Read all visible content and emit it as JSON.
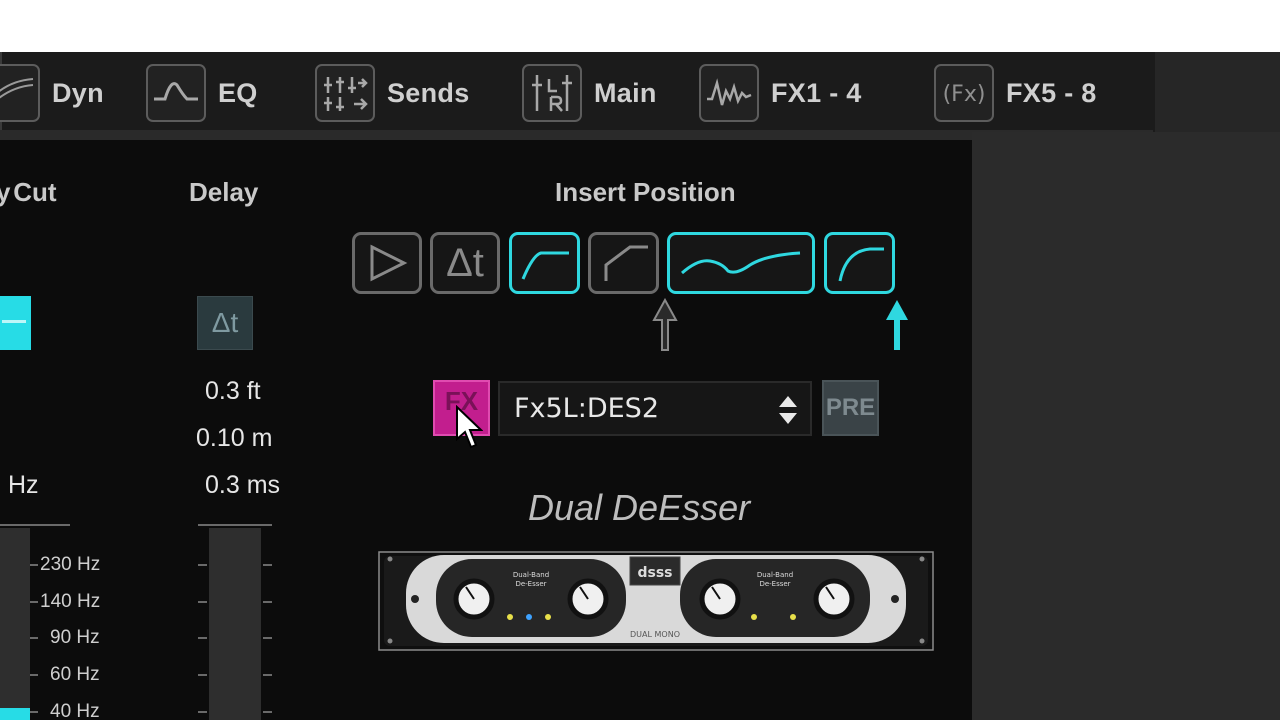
{
  "tabs": [
    {
      "label": "Dyn",
      "icon": "dynamics-icon"
    },
    {
      "label": "EQ",
      "icon": "eq-curve-icon"
    },
    {
      "label": "Sends",
      "icon": "sends-faders-icon"
    },
    {
      "label": "Main",
      "icon": "main-lr-icon"
    },
    {
      "label": "FX1 - 4",
      "icon": "fx-wave-icon"
    },
    {
      "label": "FX5 - 8",
      "icon": "fx-bracket-icon"
    }
  ],
  "section_headers": {
    "low_cut": "Cut",
    "delay": "Delay",
    "insert_position": "Insert Position"
  },
  "low_cut": {
    "value_unit": "Hz",
    "scale": [
      "230 Hz",
      "140 Hz",
      "90 Hz",
      "60 Hz",
      "40 Hz"
    ]
  },
  "delay": {
    "button_label": "Δt",
    "feet": "0.3 ft",
    "meters": "0.10 m",
    "ms": "0.3 ms"
  },
  "insert_positions": [
    {
      "name": "input",
      "icon": "play-triangle-icon",
      "active": false
    },
    {
      "name": "delay",
      "icon": "delta-t-icon",
      "label": "Δt",
      "active": false
    },
    {
      "name": "low-cut",
      "icon": "low-cut-curve-icon",
      "active": true
    },
    {
      "name": "gate",
      "icon": "gate-curve-icon",
      "active": false
    },
    {
      "name": "eq",
      "icon": "eq-wave-icon",
      "active": true
    },
    {
      "name": "dynamics",
      "icon": "compressor-curve-icon",
      "active": true
    }
  ],
  "fx_insert": {
    "fx_button_label": "FX",
    "selected": "Fx5L:DES2",
    "pre_label": "PRE"
  },
  "plugin": {
    "name": "Dual DeEsser",
    "panel_text": {
      "left_title": "Dual-Band\nDe-Esser",
      "right_title": "Dual-Band\nDe-Esser",
      "brand": "dsss",
      "footer": "DUAL MONO"
    }
  },
  "colors": {
    "accent_cyan": "#2fd8e0",
    "fx_magenta": "#c21e8e",
    "background": "#0c0c0c",
    "tab_bar": "#1b1b1b"
  }
}
